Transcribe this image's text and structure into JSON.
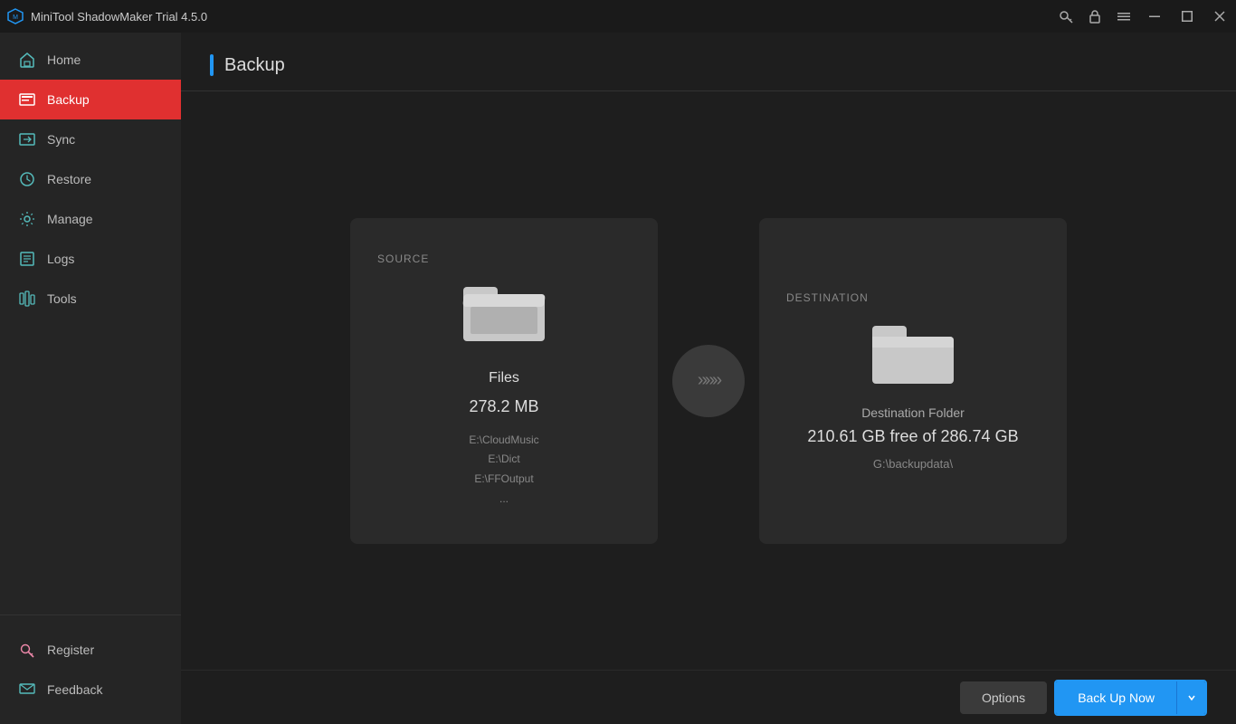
{
  "titleBar": {
    "title": "MiniTool ShadowMaker Trial 4.5.0",
    "controls": [
      "key-icon",
      "lock-icon",
      "menu-icon",
      "minimize-icon",
      "maximize-icon",
      "close-icon"
    ]
  },
  "sidebar": {
    "items": [
      {
        "id": "home",
        "label": "Home",
        "icon": "home-icon",
        "active": false
      },
      {
        "id": "backup",
        "label": "Backup",
        "icon": "backup-icon",
        "active": true
      },
      {
        "id": "sync",
        "label": "Sync",
        "icon": "sync-icon",
        "active": false
      },
      {
        "id": "restore",
        "label": "Restore",
        "icon": "restore-icon",
        "active": false
      },
      {
        "id": "manage",
        "label": "Manage",
        "icon": "manage-icon",
        "active": false
      },
      {
        "id": "logs",
        "label": "Logs",
        "icon": "logs-icon",
        "active": false
      },
      {
        "id": "tools",
        "label": "Tools",
        "icon": "tools-icon",
        "active": false
      }
    ],
    "bottomItems": [
      {
        "id": "register",
        "label": "Register",
        "icon": "register-icon"
      },
      {
        "id": "feedback",
        "label": "Feedback",
        "icon": "feedback-icon"
      }
    ]
  },
  "page": {
    "title": "Backup"
  },
  "source": {
    "label": "SOURCE",
    "name": "Files",
    "size": "278.2 MB",
    "paths": [
      "E:\\CloudMusic",
      "E:\\Dict",
      "E:\\FFOutput",
      "..."
    ]
  },
  "destination": {
    "label": "DESTINATION",
    "name": "Destination Folder",
    "freeSpace": "210.61 GB free of 286.74 GB",
    "path": "G:\\backupdata\\"
  },
  "buttons": {
    "options": "Options",
    "backupNow": "Back Up Now"
  }
}
